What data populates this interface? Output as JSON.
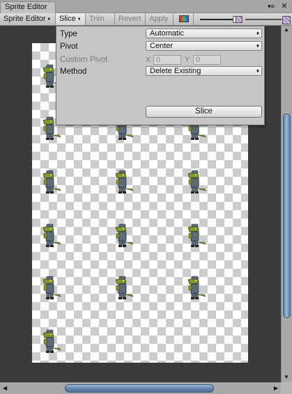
{
  "window": {
    "tab_title": "Sprite Editor",
    "menu_icon": "context-menu-icon",
    "close_icon": "close-icon"
  },
  "toolbar": {
    "sprite_editor_label": "Sprite Editor",
    "slice_label": "Slice",
    "trim_label": "Trim",
    "revert_label": "Revert",
    "apply_label": "Apply",
    "dropdown_arrow": "♦",
    "color_toggle_icon": "rgb-channels-icon",
    "zoom_icon": "zoom-slider",
    "mip_icon": "mip-level-icon"
  },
  "slice_popup": {
    "type_label": "Type",
    "type_value": "Automatic",
    "pivot_label": "Pivot",
    "pivot_value": "Center",
    "custom_pivot_label": "Custom Pivot",
    "x_label": "X",
    "x_value": "0",
    "y_label": "Y",
    "y_value": "0",
    "method_label": "Method",
    "method_value": "Delete Existing",
    "slice_button_label": "Slice",
    "dropdown_arrow": "♦"
  },
  "canvas": {
    "content": "crocodile-soldier-sprite-sheet",
    "sprite_rows": 6,
    "sprite_columns": 3,
    "visible_sprites": 16
  },
  "colors": {
    "window_bg": "#c2c2c2",
    "canvas_bg": "#3a3a3a",
    "scroll_thumb": "#7a9abf",
    "croc_green": "#7c9a2e",
    "uniform_gray": "#5d6b78"
  },
  "scrollbars": {
    "up_arrow": "▲",
    "down_arrow": "▼",
    "left_arrow": "◀",
    "right_arrow": "▶"
  }
}
